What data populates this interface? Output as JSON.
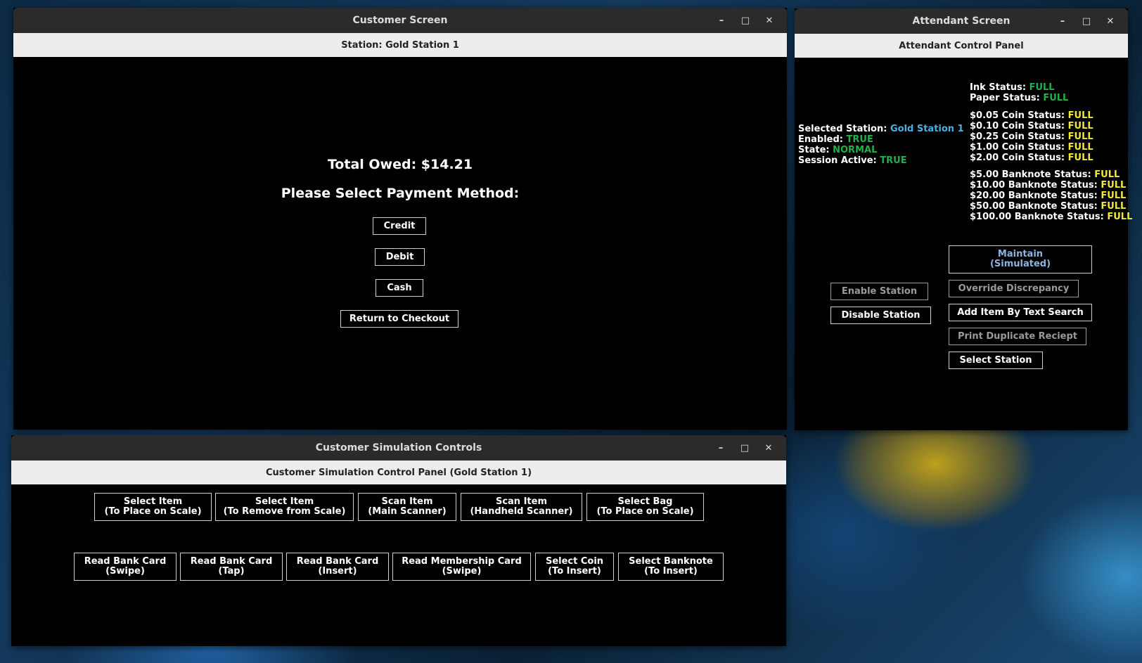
{
  "customer_screen": {
    "title": "Customer Screen",
    "header": "Station: Gold Station 1",
    "total_owed": "Total Owed: $14.21",
    "prompt": "Please Select Payment Method:",
    "buttons": {
      "credit": "Credit",
      "debit": "Debit",
      "cash": "Cash",
      "return": "Return to Checkout"
    }
  },
  "attendant_screen": {
    "title": "Attendant Screen",
    "header": "Attendant Control Panel",
    "station_info": {
      "selected_label": "Selected Station:",
      "selected_value": "Gold Station 1",
      "enabled_label": "Enabled:",
      "enabled_value": "TRUE",
      "state_label": "State:",
      "state_value": "NORMAL",
      "session_label": "Session Active:",
      "session_value": "TRUE"
    },
    "ink_label": "Ink Status:",
    "ink_value": "FULL",
    "paper_label": "Paper Status:",
    "paper_value": "FULL",
    "coin_status": [
      {
        "label": "$0.05 Coin Status:",
        "value": "FULL"
      },
      {
        "label": "$0.10 Coin Status:",
        "value": "FULL"
      },
      {
        "label": "$0.25 Coin Status:",
        "value": "FULL"
      },
      {
        "label": "$1.00 Coin Status:",
        "value": "FULL"
      },
      {
        "label": "$2.00 Coin Status:",
        "value": "FULL"
      }
    ],
    "banknote_status": [
      {
        "label": "$5.00 Banknote Status:",
        "value": "FULL"
      },
      {
        "label": "$10.00 Banknote Status:",
        "value": "FULL"
      },
      {
        "label": "$20.00 Banknote Status:",
        "value": "FULL"
      },
      {
        "label": "$50.00 Banknote Status:",
        "value": "FULL"
      },
      {
        "label": "$100.00 Banknote Status:",
        "value": "FULL"
      }
    ],
    "buttons": {
      "maintain": "Maintain\n(Simulated)",
      "enable_station": "Enable Station",
      "override_discrepancy": "Override Discrepancy",
      "disable_station": "Disable Station",
      "add_item_text_search": "Add Item By Text Search",
      "print_duplicate": "Print Duplicate Reciept",
      "select_station": "Select Station"
    }
  },
  "simulation_controls": {
    "title": "Customer Simulation Controls",
    "header": "Customer Simulation Control Panel (Gold Station 1)",
    "row1": [
      "Select Item\n(To Place on Scale)",
      "Select Item\n(To Remove from Scale)",
      "Scan Item\n(Main Scanner)",
      "Scan Item\n(Handheld Scanner)",
      "Select Bag\n(To Place on Scale)"
    ],
    "row2": [
      "Read Bank Card\n(Swipe)",
      "Read Bank Card\n(Tap)",
      "Read Bank Card\n(Insert)",
      "Read Membership Card\n(Swipe)",
      "Select Coin\n(To Insert)",
      "Select Banknote\n(To Insert)"
    ]
  },
  "window_controls": {
    "minimize": "–",
    "maximize": "□",
    "close": "✕"
  },
  "colors": {
    "status_green": "#22b04a",
    "status_yellow": "#f2e83a",
    "station_cyan": "#4ab0e0"
  }
}
